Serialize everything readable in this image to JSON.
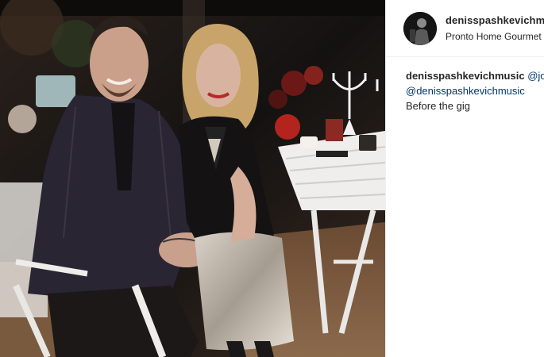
{
  "post": {
    "username": "denisspashkevichmusic",
    "location": "Pronto Home Gourmet",
    "caption": {
      "username": "denisspashkevichmusic",
      "mention_1": "@jo",
      "mention_2": "@denisspashkevichmusic",
      "text": "Before the gig"
    }
  },
  "colors": {
    "text": "#262626",
    "mention": "#003569",
    "divider": "#efefef",
    "photo_bg": "#1a1614"
  },
  "icons": {
    "avatar": "profile-photo"
  }
}
